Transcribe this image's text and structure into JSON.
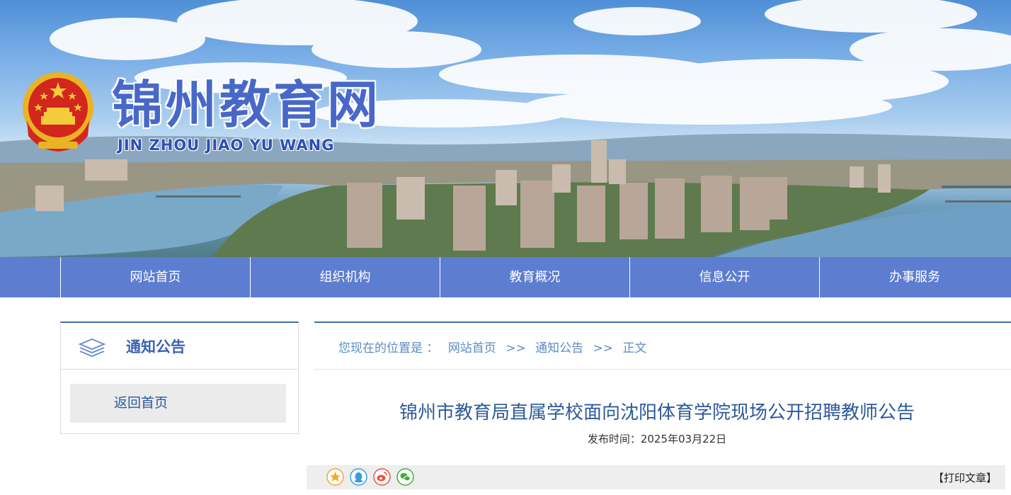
{
  "header": {
    "site_title": "锦州教育网",
    "site_pinyin": "JIN ZHOU JIAO YU WANG"
  },
  "nav": {
    "items": [
      {
        "label": "网站首页"
      },
      {
        "label": "组织机构"
      },
      {
        "label": "教育概况"
      },
      {
        "label": "信息公开"
      },
      {
        "label": "办事服务"
      }
    ]
  },
  "sidebar": {
    "title": "通知公告",
    "links": [
      {
        "label": "返回首页"
      }
    ]
  },
  "breadcrumb": {
    "prefix": "您现在的位置是 ：",
    "items": [
      "网站首页",
      "通知公告",
      "正文"
    ],
    "separator": ">>"
  },
  "article": {
    "title": "锦州市教育局直属学校面向沈阳体育学院现场公开招聘教师公告",
    "publish_time": "发布时间：2025年03月22日"
  },
  "toolbar": {
    "share_icons": [
      {
        "icon": "favorite-star-icon",
        "color": "#f5a623"
      },
      {
        "icon": "qq-icon",
        "color": "#3a9be0"
      },
      {
        "icon": "weibo-icon",
        "color": "#e8543d"
      },
      {
        "icon": "wechat-icon",
        "color": "#3cb034"
      }
    ],
    "print_label": "【打印文章】"
  },
  "colors": {
    "nav_bg": "#5d7dd0",
    "accent": "#3f6fb0",
    "title_blue": "#2d5a9a"
  }
}
